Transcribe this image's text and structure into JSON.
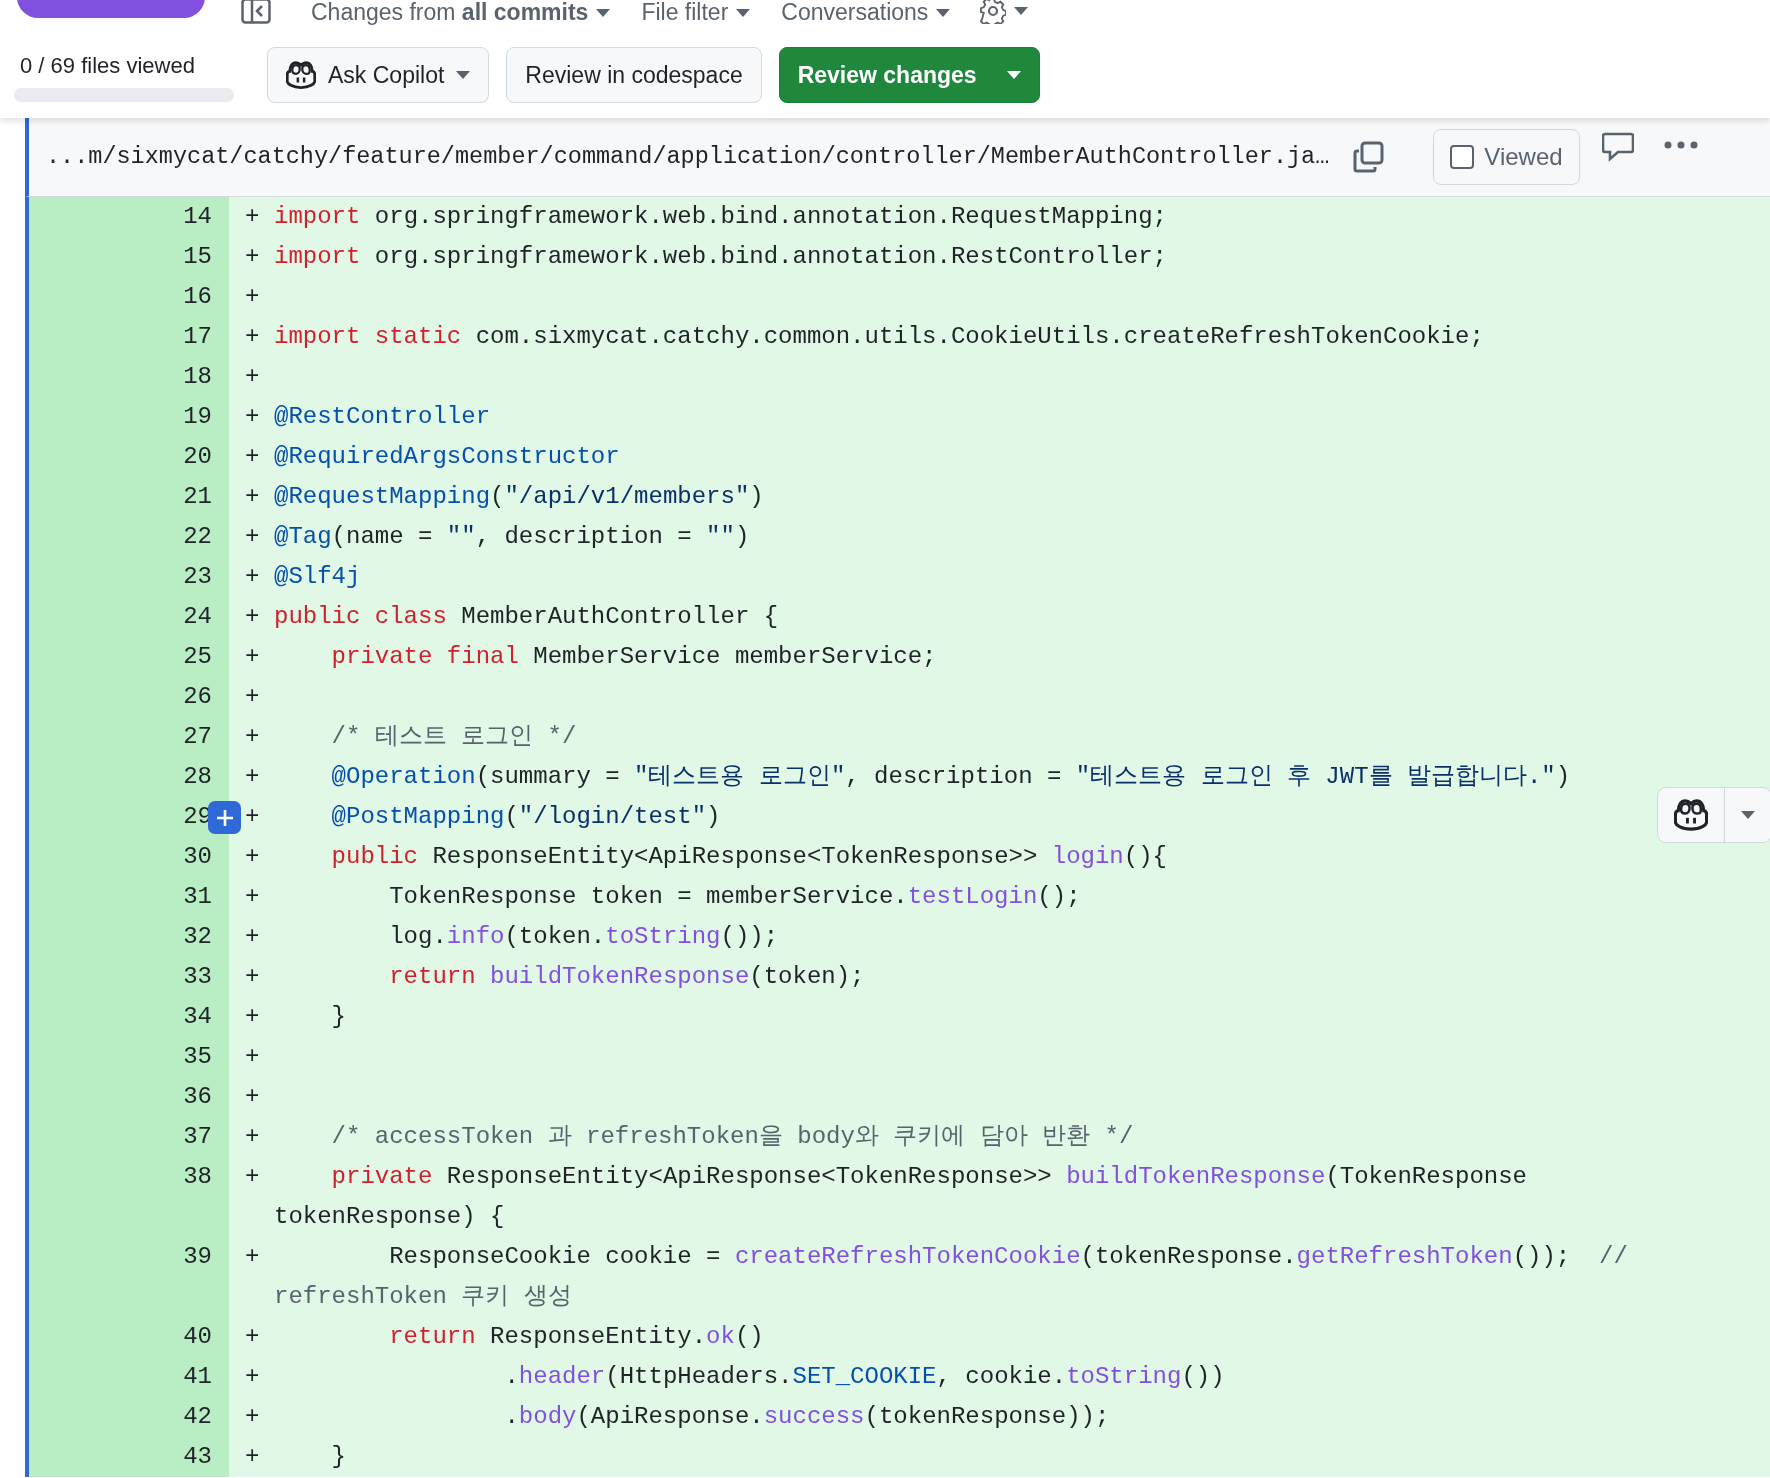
{
  "top_bar": {
    "changes": "Changes from **all commits**",
    "filters": [
      "File filter",
      "Conversations"
    ]
  },
  "progress": {
    "label": "0 / 69 files viewed",
    "level": 0
  },
  "buttons": [
    {
      "label": "Ask Copilot",
      "kind": "copilot"
    },
    {
      "label": "Review in codespace",
      "kind": "plain"
    },
    {
      "label": "Review changes",
      "kind": "primary"
    }
  ],
  "file": {
    "path": "...m/sixmycat/catchy/feature/member/command/application/controller/MemberAuthController.ja…",
    "viewed_label": "Viewed",
    "viewed": false
  },
  "lines": [
    {
      "number": "14",
      "sign": "+",
      "hovered": false,
      "tokens": [
        {
          "kind": "kw",
          "text": "import"
        },
        {
          "kind": "plain",
          "text": " org.springframework.web.bind.annotation.RequestMapping;"
        }
      ]
    },
    {
      "number": "15",
      "sign": "+",
      "hovered": false,
      "tokens": [
        {
          "kind": "kw",
          "text": "import"
        },
        {
          "kind": "plain",
          "text": " org.springframework.web.bind.annotation.RestController;"
        }
      ]
    },
    {
      "number": "16",
      "sign": "+",
      "hovered": false
    },
    {
      "number": "17",
      "sign": "+",
      "hovered": false,
      "tokens": [
        {
          "kind": "kw",
          "text": "import static"
        },
        {
          "kind": "plain",
          "text": " com.sixmycat.catchy.common.utils.CookieUtils.createRefreshTokenCookie;"
        }
      ]
    },
    {
      "number": "18",
      "sign": "+",
      "hovered": false
    },
    {
      "number": "19",
      "sign": "+",
      "hovered": false,
      "tokens": [
        {
          "kind": "ann",
          "text": "@RestController"
        }
      ]
    },
    {
      "number": "20",
      "sign": "+",
      "hovered": false,
      "tokens": [
        {
          "kind": "ann",
          "text": "@RequiredArgsConstructor"
        }
      ]
    },
    {
      "number": "21",
      "sign": "+",
      "hovered": false,
      "tokens": [
        {
          "kind": "ann",
          "text": "@RequestMapping"
        },
        {
          "kind": "plain",
          "text": "("
        },
        {
          "kind": "str",
          "text": "\"/api/v1/members\""
        },
        {
          "kind": "plain",
          "text": ")"
        }
      ]
    },
    {
      "number": "22",
      "sign": "+",
      "hovered": false,
      "tokens": [
        {
          "kind": "ann",
          "text": "@Tag"
        },
        {
          "kind": "plain",
          "text": "(name = "
        },
        {
          "kind": "str",
          "text": "\"\""
        },
        {
          "kind": "plain",
          "text": ", description = "
        },
        {
          "kind": "str",
          "text": "\"\""
        },
        {
          "kind": "plain",
          "text": ")"
        }
      ]
    },
    {
      "number": "23",
      "sign": "+",
      "hovered": false,
      "tokens": [
        {
          "kind": "ann",
          "text": "@Slf4j"
        }
      ]
    },
    {
      "number": "24",
      "sign": "+",
      "hovered": false,
      "tokens": [
        {
          "kind": "kw",
          "text": "public class"
        },
        {
          "kind": "plain",
          "text": " MemberAuthController {"
        }
      ]
    },
    {
      "number": "25",
      "sign": "+",
      "hovered": false,
      "tokens": [
        {
          "kind": "kw",
          "text": "    private final"
        },
        {
          "kind": "plain",
          "text": " MemberService memberService;"
        }
      ]
    },
    {
      "number": "26",
      "sign": "+",
      "hovered": false
    },
    {
      "number": "27",
      "sign": "+",
      "hovered": false,
      "tokens": [
        {
          "kind": "cmt",
          "text": "    /* 테스트 로그인 */"
        }
      ]
    },
    {
      "number": "28",
      "sign": "+",
      "hovered": false,
      "tokens": [
        {
          "kind": "ann",
          "text": "    @Operation"
        },
        {
          "kind": "plain",
          "text": "(summary = "
        },
        {
          "kind": "str",
          "text": "\"테스트용 로그인\""
        },
        {
          "kind": "plain",
          "text": ", description = "
        },
        {
          "kind": "str",
          "text": "\"테스트용 로그인 후 JWT를 발급합니다.\""
        },
        {
          "kind": "plain",
          "text": ")"
        }
      ]
    },
    {
      "number": "29",
      "sign": "+",
      "hovered": true,
      "tokens": [
        {
          "kind": "ann",
          "text": "    @PostMapping"
        },
        {
          "kind": "plain",
          "text": "("
        },
        {
          "kind": "str",
          "text": "\"/login/test\""
        },
        {
          "kind": "plain",
          "text": ")"
        }
      ]
    },
    {
      "number": "30",
      "sign": "+",
      "hovered": false,
      "tokens": [
        {
          "kind": "kw",
          "text": "    public"
        },
        {
          "kind": "plain",
          "text": " ResponseEntity<ApiResponse<TokenResponse>> "
        },
        {
          "kind": "fn",
          "text": "login"
        },
        {
          "kind": "plain",
          "text": "(){"
        }
      ]
    },
    {
      "number": "31",
      "sign": "+",
      "hovered": false,
      "tokens": [
        {
          "kind": "plain",
          "text": "        TokenResponse token = memberService."
        },
        {
          "kind": "fn",
          "text": "testLogin"
        },
        {
          "kind": "plain",
          "text": "();"
        }
      ]
    },
    {
      "number": "32",
      "sign": "+",
      "hovered": false,
      "tokens": [
        {
          "kind": "plain",
          "text": "        log."
        },
        {
          "kind": "fn",
          "text": "info"
        },
        {
          "kind": "plain",
          "text": "(token."
        },
        {
          "kind": "fn",
          "text": "toString"
        },
        {
          "kind": "plain",
          "text": "());"
        }
      ]
    },
    {
      "number": "33",
      "sign": "+",
      "hovered": false,
      "tokens": [
        {
          "kind": "kw",
          "text": "        return "
        },
        {
          "kind": "fn",
          "text": "buildTokenResponse"
        },
        {
          "kind": "plain",
          "text": "(token);"
        }
      ]
    },
    {
      "number": "34",
      "sign": "+",
      "hovered": false,
      "tokens": [
        {
          "kind": "plain",
          "text": "    }"
        }
      ]
    },
    {
      "number": "35",
      "sign": "+",
      "hovered": false
    },
    {
      "number": "36",
      "sign": "+",
      "hovered": false
    },
    {
      "number": "37",
      "sign": "+",
      "hovered": false,
      "tokens": [
        {
          "kind": "cmt",
          "text": "    /* accessToken 과 refreshToken을 body와 쿠키에 담아 반환 */"
        }
      ]
    },
    {
      "number": "38",
      "sign": "+",
      "hovered": false,
      "tokens": [
        {
          "kind": "kw",
          "text": "    private"
        },
        {
          "kind": "plain",
          "text": " ResponseEntity<ApiResponse<TokenResponse>> "
        },
        {
          "kind": "fn",
          "text": "buildTokenResponse"
        },
        {
          "kind": "plain",
          "text": "(TokenResponse tokenResponse) {"
        }
      ]
    },
    {
      "number": "39",
      "sign": "+",
      "hovered": false,
      "tokens": [
        {
          "kind": "plain",
          "text": "        ResponseCookie cookie = "
        },
        {
          "kind": "fn",
          "text": "createRefreshTokenCookie"
        },
        {
          "kind": "plain",
          "text": "(tokenResponse."
        },
        {
          "kind": "fn",
          "text": "getRefreshToken"
        },
        {
          "kind": "plain",
          "text": "());  "
        },
        {
          "kind": "cmt",
          "text": "// refreshToken 쿠키 생성"
        }
      ]
    },
    {
      "number": "40",
      "sign": "+",
      "hovered": false,
      "tokens": [
        {
          "kind": "kw",
          "text": "        return"
        },
        {
          "kind": "plain",
          "text": " ResponseEntity."
        },
        {
          "kind": "fn",
          "text": "ok"
        },
        {
          "kind": "plain",
          "text": "()"
        }
      ]
    },
    {
      "number": "41",
      "sign": "+",
      "hovered": false,
      "tokens": [
        {
          "kind": "plain",
          "text": "                ."
        },
        {
          "kind": "fn",
          "text": "header"
        },
        {
          "kind": "plain",
          "text": "(HttpHeaders."
        },
        {
          "kind": "const",
          "text": "SET_COOKIE"
        },
        {
          "kind": "plain",
          "text": ", cookie."
        },
        {
          "kind": "fn",
          "text": "toString"
        },
        {
          "kind": "plain",
          "text": "())"
        }
      ]
    },
    {
      "number": "42",
      "sign": "+",
      "hovered": false,
      "tokens": [
        {
          "kind": "plain",
          "text": "                ."
        },
        {
          "kind": "fn",
          "text": "body"
        },
        {
          "kind": "plain",
          "text": "(ApiResponse."
        },
        {
          "kind": "fn",
          "text": "success"
        },
        {
          "kind": "plain",
          "text": "(tokenResponse));"
        }
      ]
    },
    {
      "number": "43",
      "sign": "+",
      "hovered": false,
      "tokens": [
        {
          "kind": "plain",
          "text": "    }"
        }
      ]
    }
  ]
}
